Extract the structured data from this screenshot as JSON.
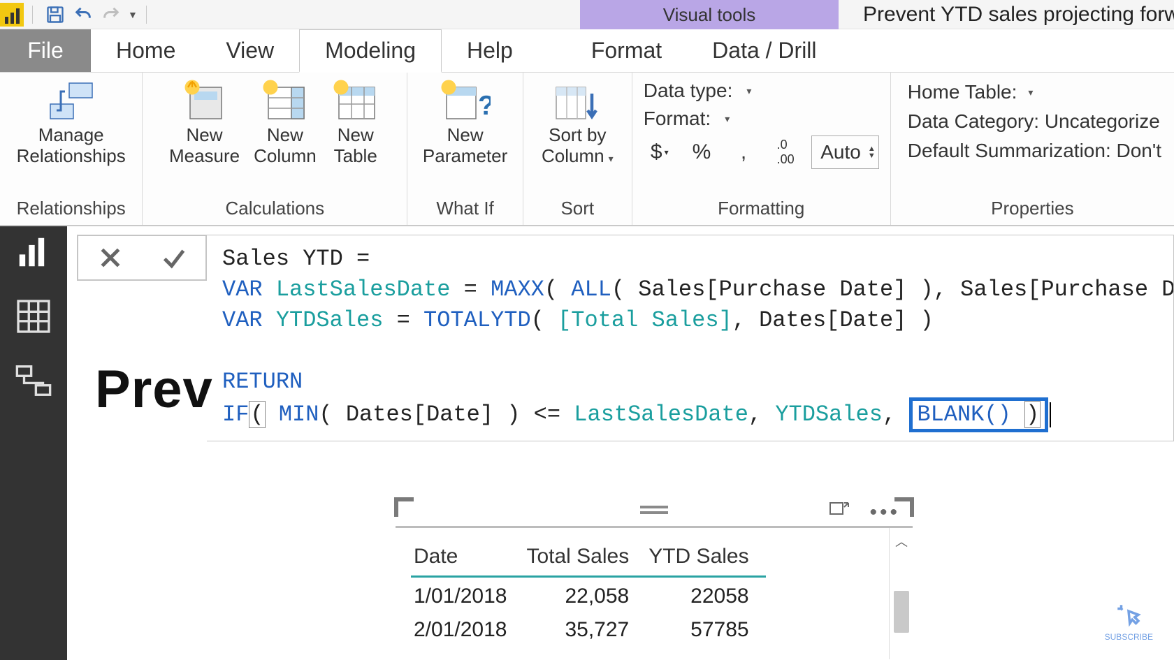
{
  "titlebar": {
    "context_tab": "Visual tools",
    "doc_title": "Prevent YTD sales projecting forwa"
  },
  "tabs": {
    "file": "File",
    "items": [
      "Home",
      "View",
      "Modeling",
      "Help",
      "Format",
      "Data / Drill"
    ],
    "active_index": 2
  },
  "ribbon": {
    "relationships": {
      "manage": "Manage\nRelationships",
      "group": "Relationships"
    },
    "calculations": {
      "new_measure": "New\nMeasure",
      "new_column": "New\nColumn",
      "new_table": "New\nTable",
      "group": "Calculations"
    },
    "whatif": {
      "new_parameter": "New\nParameter",
      "group": "What If"
    },
    "sort": {
      "sort_by_column": "Sort by\nColumn",
      "group": "Sort"
    },
    "formatting": {
      "data_type": "Data type:",
      "format": "Format:",
      "auto": "Auto",
      "group": "Formatting"
    },
    "properties": {
      "home_table": "Home Table:",
      "data_category": "Data Category: Uncategorize",
      "default_summarization": "Default Summarization: Don't",
      "group": "Properties"
    }
  },
  "page_title_fragment": "Prev",
  "formula": {
    "line1_a": "Sales YTD = ",
    "line2_var": "VAR",
    "line2_id": "LastSalesDate",
    "line2_eq": " = ",
    "line2_fn1": "MAXX",
    "line2_p1": "( ",
    "line2_fn2": "ALL",
    "line2_p2": "( Sales[Purchase Date] ), Sales[Purchase Date] )",
    "line3_var": "VAR",
    "line3_id": "YTDSales",
    "line3_eq": " = ",
    "line3_fn": "TOTALYTD",
    "line3_p1": "( ",
    "line3_ref": "[Total Sales]",
    "line3_p2": ", Dates[Date] )",
    "line5_return": "RETURN",
    "line6_if": "IF",
    "line6_p1": "(",
    "line6_sp": " ",
    "line6_fn": "MIN",
    "line6_p2": "( Dates[Date] ) <= ",
    "line6_id1": "LastSalesDate",
    "line6_c1": ", ",
    "line6_id2": "YTDSales",
    "line6_c2": ", ",
    "line6_blank": "BLANK() ",
    "line6_close": ")"
  },
  "table": {
    "headers": [
      "Date",
      "Total Sales",
      "YTD Sales"
    ],
    "rows": [
      {
        "date": "1/01/2018",
        "total": "22,058",
        "ytd": "22058"
      },
      {
        "date": "2/01/2018",
        "total": "35,727",
        "ytd": "57785"
      }
    ]
  },
  "subscribe": "SUBSCRIBE"
}
